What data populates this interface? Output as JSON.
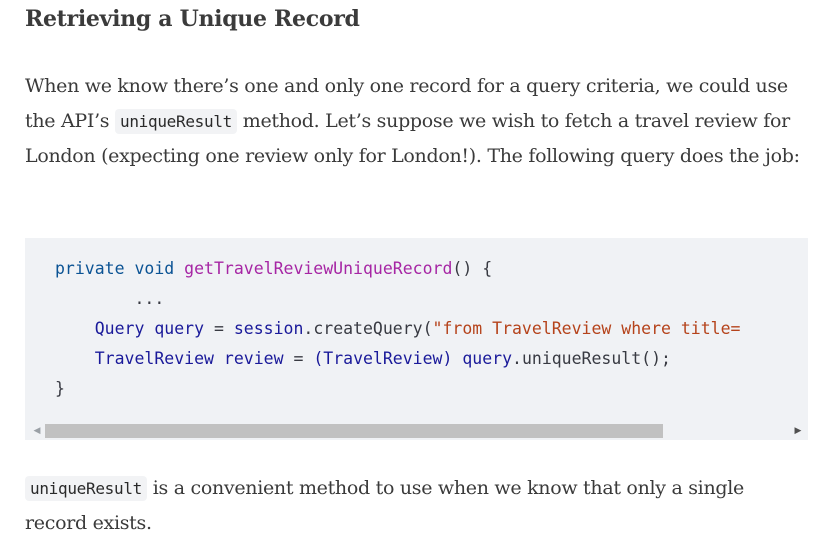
{
  "heading": "Retrieving a Unique Record",
  "para1": {
    "before": "When we know there’s one and only one record for a query criteria, we could use the API’s ",
    "code": "uniqueResult",
    "after": " method. Let’s suppose we wish to fetch a travel review for London (expecting one review only for London!). The following query does the job:"
  },
  "code": {
    "line1": {
      "kw1": "private",
      "kw2": "void",
      "fn": "getTravelReviewUniqueRecord",
      "rest": "() {"
    },
    "line2": "...",
    "line3": {
      "type": "Query",
      "var": "query",
      "eq": " = ",
      "obj": "session",
      "call": ".createQuery(",
      "str": "\"from TravelReview where title="
    },
    "line4": {
      "type": "TravelReview",
      "var": "review",
      "eq": " = ",
      "cast": "(TravelReview)",
      "obj": "query",
      "call": ".uniqueResult();"
    },
    "line5": "}"
  },
  "scrollbar": {
    "left_icon": "scroll-left-arrow-icon",
    "right_icon": "scroll-right-arrow-icon"
  },
  "para2": {
    "code": "uniqueResult",
    "after": " is a convenient method to use when we know that only a single record exists."
  }
}
